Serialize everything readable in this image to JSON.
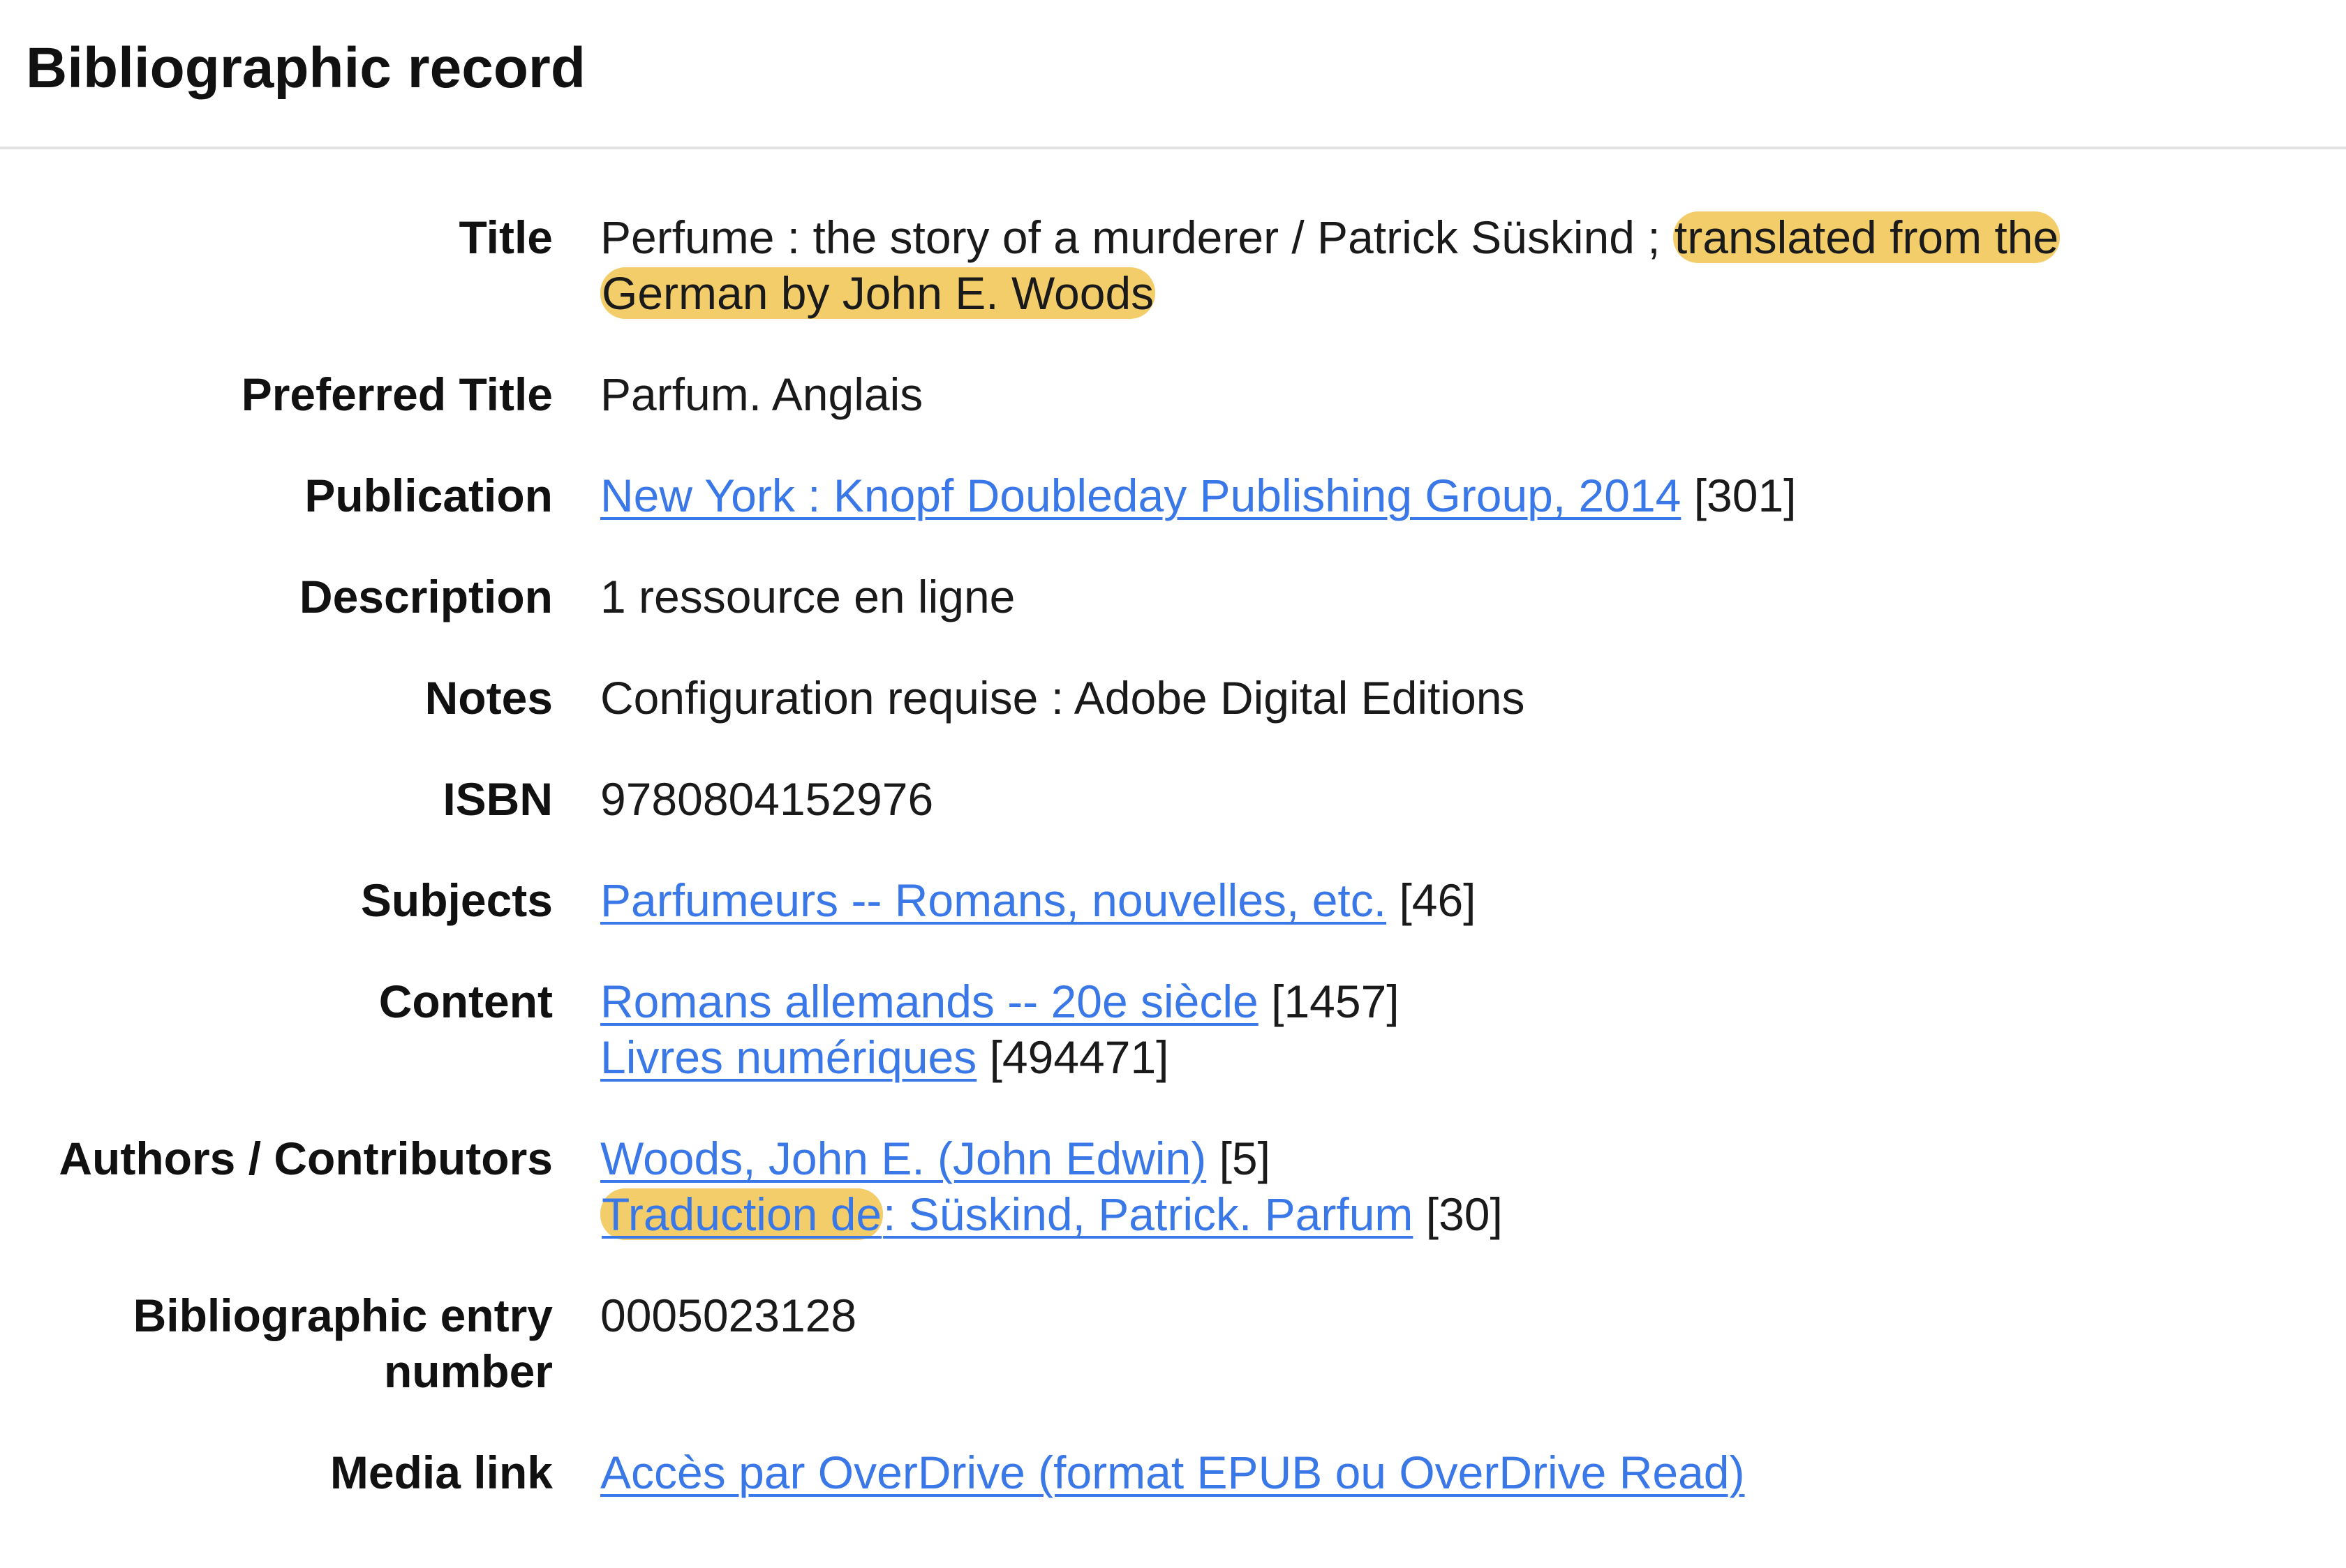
{
  "header": {
    "title": "Bibliographic record"
  },
  "record": {
    "title": {
      "label": "Title",
      "text_plain": "Perfume : the story of a murderer / Patrick Süskind ; ",
      "text_highlight_1": "translated from the",
      "text_highlight_2": "German by John E. Woods"
    },
    "preferred_title": {
      "label": "Preferred Title",
      "value": "Parfum. Anglais"
    },
    "publication": {
      "label": "Publication",
      "link": "New York : Knopf Doubleday Publishing Group, 2014",
      "count": "[301]"
    },
    "description": {
      "label": "Description",
      "value": "1 ressource en ligne"
    },
    "notes": {
      "label": "Notes",
      "value": "Configuration requise : Adobe Digital Editions"
    },
    "isbn": {
      "label": "ISBN",
      "value": "9780804152976"
    },
    "subjects": {
      "label": "Subjects",
      "link": "Parfumeurs -- Romans, nouvelles, etc.",
      "count": "[46]"
    },
    "content": {
      "label": "Content",
      "items": [
        {
          "link": "Romans allemands -- 20e siècle",
          "count": "[1457]"
        },
        {
          "link": "Livres numériques",
          "count": "[494471]"
        }
      ]
    },
    "authors": {
      "label": "Authors / Contributors",
      "items": [
        {
          "link": "Woods, John E. (John Edwin)",
          "count": "[5]"
        },
        {
          "link_highlight": "Traduction de",
          "link_rest": ": Süskind, Patrick. Parfum",
          "count": "[30]"
        }
      ]
    },
    "entry_number": {
      "label_line_1": "Bibliographic entry",
      "label_line_2": "number",
      "value": "0005023128"
    },
    "media_link": {
      "label": "Media link",
      "link": "Accès par OverDrive (format EPUB ou OverDrive Read)"
    }
  },
  "colors": {
    "link": "#3b78e7",
    "highlight": "#f2cd6a",
    "divider": "#e2e2e2"
  }
}
